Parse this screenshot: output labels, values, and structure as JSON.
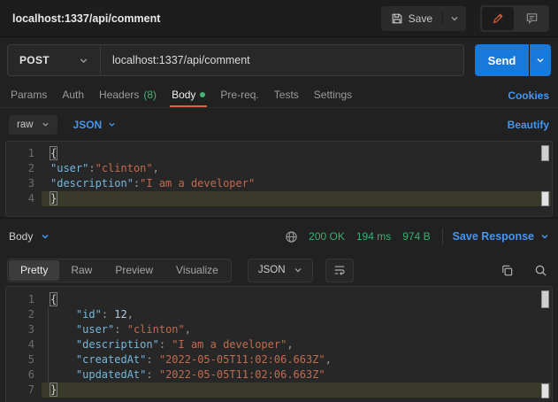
{
  "colors": {
    "accent_orange": "#e05f3d",
    "link_blue": "#4596f0",
    "success_green": "#42b374",
    "send_blue": "#1779da",
    "key_blue": "#77b7d9",
    "string_red": "#c06b51",
    "highlight_line": "#3a3a2b"
  },
  "header": {
    "title": "localhost:1337/api/comment",
    "save_label": "Save"
  },
  "request": {
    "method": "POST",
    "url": "localhost:1337/api/comment",
    "send_label": "Send",
    "tabs": [
      {
        "label": "Params"
      },
      {
        "label": "Auth"
      },
      {
        "label": "Headers",
        "count": "(8)"
      },
      {
        "label": "Body"
      },
      {
        "label": "Pre-req."
      },
      {
        "label": "Tests"
      },
      {
        "label": "Settings"
      }
    ],
    "cookies_label": "Cookies",
    "body_type": "raw",
    "language": "JSON",
    "beautify_label": "Beautify",
    "editor": {
      "lines": [
        {
          "n": "1",
          "hl": false,
          "tok": [
            {
              "t": "{",
              "y": "bb"
            }
          ]
        },
        {
          "n": "2",
          "hl": false,
          "tok": [
            {
              "t": "\"user\"",
              "y": "k"
            },
            {
              "t": ":",
              "y": "p"
            },
            {
              "t": "\"clinton\"",
              "y": "s"
            },
            {
              "t": ",",
              "y": "p"
            }
          ]
        },
        {
          "n": "3",
          "hl": false,
          "tok": [
            {
              "t": "\"description\"",
              "y": "k"
            },
            {
              "t": ":",
              "y": "p"
            },
            {
              "t": "\"I am a developer\"",
              "y": "s"
            }
          ]
        },
        {
          "n": "4",
          "hl": true,
          "tok": [
            {
              "t": "}",
              "y": "bb"
            }
          ]
        }
      ]
    }
  },
  "response": {
    "body_label": "Body",
    "status": "200 OK",
    "time": "194 ms",
    "size": "974 B",
    "save_response_label": "Save Response",
    "tabs": [
      {
        "label": "Pretty"
      },
      {
        "label": "Raw"
      },
      {
        "label": "Preview"
      },
      {
        "label": "Visualize"
      }
    ],
    "language": "JSON",
    "editor": {
      "lines": [
        {
          "n": "1",
          "hl": false,
          "tok": [
            {
              "t": "{",
              "y": "bb"
            }
          ]
        },
        {
          "n": "2",
          "hl": false,
          "tok": [
            {
              "t": "    ",
              "y": "w"
            },
            {
              "t": "\"id\"",
              "y": "k"
            },
            {
              "t": ": ",
              "y": "p"
            },
            {
              "t": "12",
              "y": "n"
            },
            {
              "t": ",",
              "y": "p"
            }
          ]
        },
        {
          "n": "3",
          "hl": false,
          "tok": [
            {
              "t": "    ",
              "y": "w"
            },
            {
              "t": "\"user\"",
              "y": "k"
            },
            {
              "t": ": ",
              "y": "p"
            },
            {
              "t": "\"clinton\"",
              "y": "s"
            },
            {
              "t": ",",
              "y": "p"
            }
          ]
        },
        {
          "n": "4",
          "hl": false,
          "tok": [
            {
              "t": "    ",
              "y": "w"
            },
            {
              "t": "\"description\"",
              "y": "k"
            },
            {
              "t": ": ",
              "y": "p"
            },
            {
              "t": "\"I am a developer\"",
              "y": "s"
            },
            {
              "t": ",",
              "y": "p"
            }
          ]
        },
        {
          "n": "5",
          "hl": false,
          "tok": [
            {
              "t": "    ",
              "y": "w"
            },
            {
              "t": "\"createdAt\"",
              "y": "k"
            },
            {
              "t": ": ",
              "y": "p"
            },
            {
              "t": "\"2022-05-05T11:02:06.663Z\"",
              "y": "s"
            },
            {
              "t": ",",
              "y": "p"
            }
          ]
        },
        {
          "n": "6",
          "hl": false,
          "tok": [
            {
              "t": "    ",
              "y": "w"
            },
            {
              "t": "\"updatedAt\"",
              "y": "k"
            },
            {
              "t": ": ",
              "y": "p"
            },
            {
              "t": "\"2022-05-05T11:02:06.663Z\"",
              "y": "s"
            }
          ]
        },
        {
          "n": "7",
          "hl": true,
          "tok": [
            {
              "t": "}",
              "y": "bb"
            }
          ]
        }
      ]
    }
  }
}
